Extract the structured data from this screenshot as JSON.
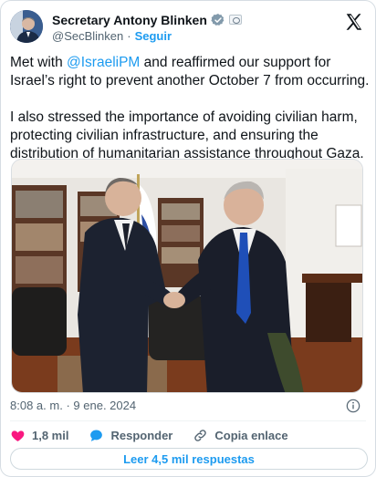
{
  "author": {
    "name": "Secretary Antony Blinken",
    "handle": "@SecBlinken",
    "separator": "·",
    "follow_label": "Seguir",
    "verified_icon": "government-verified-badge-icon",
    "flag_icon": "us-government-affiliation-icon"
  },
  "tweet": {
    "para1_before": "Met with ",
    "para1_mention": "@IsraeliPM",
    "para1_after": " and reaffirmed our support for Israel’s right to prevent another October 7 from occurring.",
    "para2": "I also stressed the importance of avoiding civilian harm, protecting civilian infrastructure, and ensuring the distribution of humanitarian assistance throughout Gaza."
  },
  "photo": {
    "icon": "photo-two-men-handshake"
  },
  "meta": {
    "time": "8:08 a. m.",
    "separator": "·",
    "date": "9 ene. 2024",
    "info_icon": "info-icon"
  },
  "actions": {
    "likes_count": "1,8 mil",
    "reply_label": "Responder",
    "copy_link_label": "Copia enlace"
  },
  "read_replies_label": "Leer 4,5 mil respuestas",
  "colors": {
    "accent": "#1d9bf0",
    "like": "#f91880",
    "text": "#0f1419",
    "muted": "#536471"
  }
}
